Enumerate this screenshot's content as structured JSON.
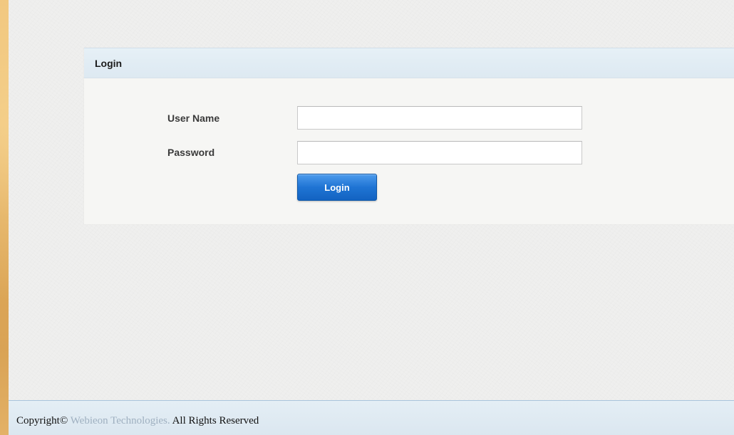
{
  "login": {
    "title": "Login",
    "username_label": "User Name",
    "username_value": "",
    "password_label": "Password",
    "password_value": "",
    "submit_label": "Login"
  },
  "footer": {
    "copyright_prefix": "Copyright©",
    "company": "Webieon Technologies.",
    "suffix": "All Rights Reserved"
  },
  "colors": {
    "outer_background": "#e8b868",
    "page_background": "#efefee",
    "header_background": "#e2edf4",
    "button_blue": "#1f74d4",
    "company_text": "#9fb0c0"
  }
}
